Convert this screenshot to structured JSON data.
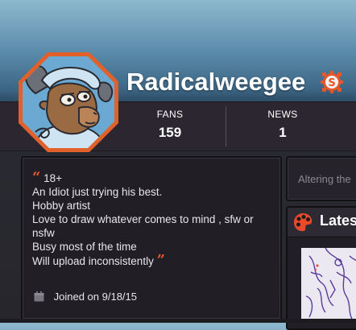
{
  "profile": {
    "username": "Radicalweegee",
    "badge_icon": "staff-s-badge-icon",
    "accent": "#e05a2a"
  },
  "stats": [
    {
      "label": "FANS",
      "value": "159"
    },
    {
      "label": "NEWS",
      "value": "1"
    }
  ],
  "bio": {
    "quote_open": "“",
    "quote_close": "”",
    "lines": [
      "18+",
      "An Idiot just trying his best.",
      "Hobby artist",
      "Love to draw whatever comes to mind , sfw or",
      "nsfw",
      "Busy most of the time",
      "Will upload inconsistently"
    ],
    "joined": "Joined on 9/18/15"
  },
  "status": {
    "text": "Altering the"
  },
  "latest": {
    "title": "Latest"
  }
}
